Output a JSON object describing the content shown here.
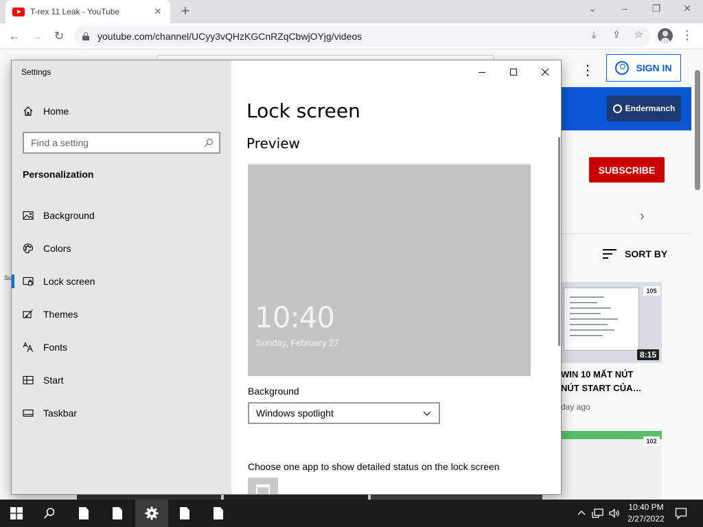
{
  "browser": {
    "tab_title": "T-rex 11 Leak - YouTube",
    "url": "youtube.com/channel/UCyy3vQHzKGCnRZqCbwjOYjg/videos"
  },
  "youtube": {
    "signin_label": "SIGN IN",
    "channel_chip": "Endermanch",
    "subscribe_label": "SUBSCRIBE",
    "sort_label": "SORT BY",
    "video1": {
      "views_badge": "105",
      "duration": "8:15",
      "title_line1": "WIN 10 MẤT NÚT",
      "title_line2": "NÚT START CỦA…",
      "meta": "day ago"
    },
    "video2": {
      "views_badge": "102"
    },
    "left_remnant": "Su"
  },
  "settings": {
    "app_title": "Settings",
    "home_label": "Home",
    "search_placeholder": "Find a setting",
    "section_label": "Personalization",
    "nav_items": [
      {
        "label": "Background",
        "icon": "image-icon"
      },
      {
        "label": "Colors",
        "icon": "palette-icon"
      },
      {
        "label": "Lock screen",
        "icon": "lock-screen-icon",
        "active": true
      },
      {
        "label": "Themes",
        "icon": "brush-icon"
      },
      {
        "label": "Fonts",
        "icon": "fonts-icon"
      },
      {
        "label": "Start",
        "icon": "start-icon"
      },
      {
        "label": "Taskbar",
        "icon": "taskbar-icon"
      }
    ],
    "page_title": "Lock screen",
    "preview_heading": "Preview",
    "preview_time": "10:40",
    "preview_date": "Sunday, February 27",
    "background_label": "Background",
    "background_value": "Windows spotlight",
    "status_label": "Choose one app to show detailed status on the lock screen"
  },
  "taskbar": {
    "clock_time": "10:40 PM",
    "clock_date": "2/27/2022"
  },
  "colors": {
    "accent": "#0078d7",
    "subscribe_red": "#cc0000",
    "youtube_blue": "#065fd4",
    "taskbar_bg": "#1b1b1b"
  }
}
